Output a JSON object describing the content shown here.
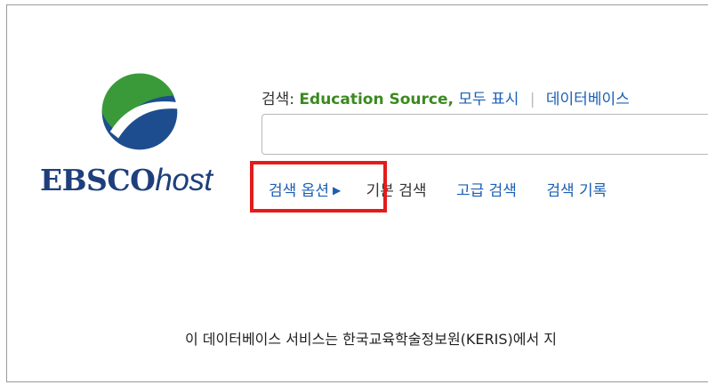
{
  "logo": {
    "brand": "EBSCO",
    "suffix": "host"
  },
  "search": {
    "label": "검색:",
    "database": "Education Source,",
    "show_all": "모두 표시",
    "choose_db": "데이터베이스",
    "input_value": ""
  },
  "links": {
    "options": "검색 옵션",
    "basic": "기본 검색",
    "advanced": "고급 검색",
    "history": "검색 기록"
  },
  "footer": {
    "text": "이 데이터베이스 서비스는 한국교육학술정보원(KERIS)에서 지"
  },
  "colors": {
    "highlight": "#e41b1b",
    "link": "#1a5fb4",
    "database": "#3b8a1f",
    "logo": "#1e3f7c"
  }
}
